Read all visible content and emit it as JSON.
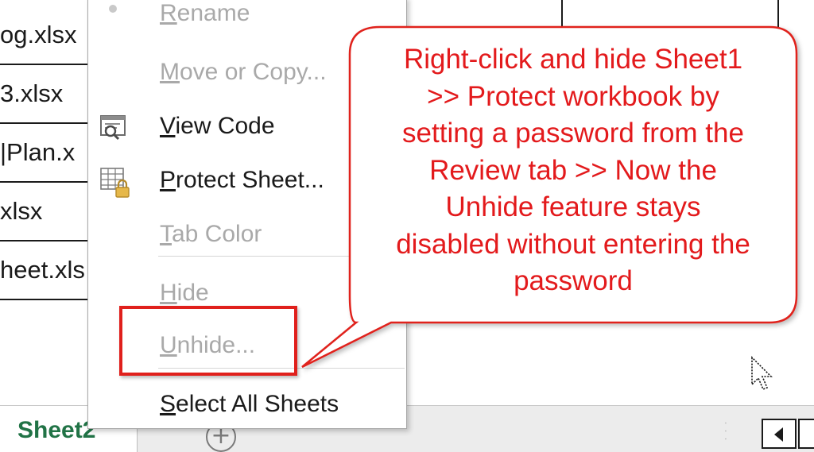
{
  "spreadsheet": {
    "file_cells": [
      "og.xlsx",
      "3.xlsx",
      "|Plan.x",
      "xlsx",
      "heet.xls"
    ]
  },
  "context_menu": {
    "items": [
      {
        "label_pre": "",
        "label_ul": "R",
        "label_post": "ename",
        "enabled": false,
        "icon": "bullet-icon"
      },
      {
        "label_pre": "",
        "label_ul": "M",
        "label_post": "ove or Copy...",
        "enabled": false,
        "icon": ""
      },
      {
        "label_pre": "",
        "label_ul": "V",
        "label_post": "iew Code",
        "enabled": true,
        "icon": "view-code-icon"
      },
      {
        "label_pre": "",
        "label_ul": "P",
        "label_post": "rotect Sheet...",
        "enabled": true,
        "icon": "protect-sheet-icon"
      },
      {
        "label_pre": "",
        "label_ul": "T",
        "label_post": "ab Color",
        "enabled": false,
        "icon": ""
      },
      {
        "label_pre": "",
        "label_ul": "H",
        "label_post": "ide",
        "enabled": false,
        "icon": ""
      },
      {
        "label_pre": "",
        "label_ul": "U",
        "label_post": "nhide...",
        "enabled": false,
        "icon": ""
      },
      {
        "label_pre": "",
        "label_ul": "S",
        "label_post": "elect All Sheets",
        "enabled": true,
        "icon": ""
      }
    ]
  },
  "callout": {
    "lines": [
      "Right-click and hide Sheet1",
      ">> Protect workbook by",
      "setting a password from the",
      "Review tab >> Now the",
      "Unhide feature stays",
      "disabled without entering the",
      "password"
    ],
    "color": "#e31a1c"
  },
  "tab_bar": {
    "active_sheet": "Sheet2",
    "add_sheet_symbol": "+",
    "sheet_color": "#217346"
  },
  "colors": {
    "highlight": "#e0201c",
    "disabled_text": "#a9a9a9",
    "enabled_text": "#1a1a1a"
  }
}
